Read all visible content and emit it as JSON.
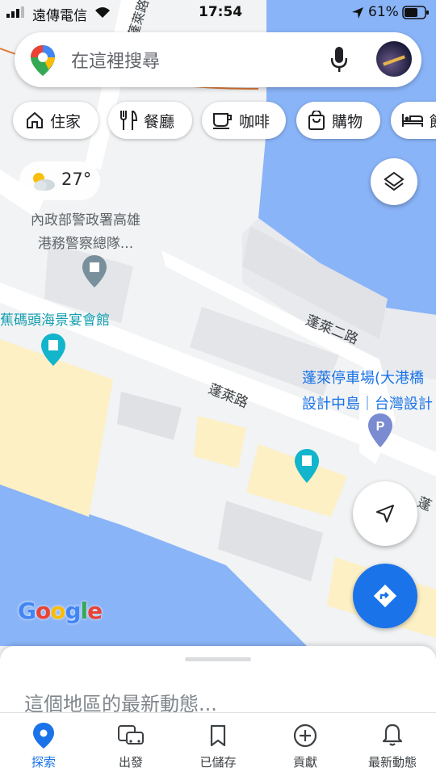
{
  "status_bar": {
    "carrier": "遠傳電信",
    "time": "17:54",
    "battery": "61%"
  },
  "search": {
    "placeholder": "在這裡搜尋"
  },
  "chips": [
    {
      "label": "住家",
      "icon": "home-icon"
    },
    {
      "label": "餐廳",
      "icon": "restaurant-icon"
    },
    {
      "label": "咖啡",
      "icon": "coffee-icon"
    },
    {
      "label": "購物",
      "icon": "shopping-bag-icon"
    },
    {
      "label": "飯",
      "icon": "hotel-icon"
    }
  ],
  "weather": {
    "temp": "27°",
    "icon": "partly-cloudy-icon"
  },
  "map": {
    "road_labels": [
      "蓬萊路",
      "蓬萊二路",
      "蓬萊路",
      "蓬"
    ],
    "places": [
      {
        "name_line1": "內政部警政署高雄",
        "name_line2": "港務警察總隊...",
        "color": "#5f6368"
      },
      {
        "name_line1": "蕉碼頭海景宴會館",
        "color": "#129eaf"
      },
      {
        "name_line1": "蓬萊停車場(大港橋",
        "name_line2": "設計中島｜台灣設計",
        "color": "#1a73e8"
      }
    ],
    "brand": "Google",
    "colors": {
      "water": "#8ab4f8",
      "land": "#f1f3f4",
      "block": "#fdf0c4",
      "building": "#e3e5e8"
    }
  },
  "sheet": {
    "title": "這個地區的最新動態..."
  },
  "bottom_nav": [
    {
      "label": "探索",
      "icon": "explore-pin-icon",
      "active": true
    },
    {
      "label": "出發",
      "icon": "commute-icon"
    },
    {
      "label": "已儲存",
      "icon": "bookmark-icon"
    },
    {
      "label": "貢獻",
      "icon": "add-circle-icon"
    },
    {
      "label": "最新動態",
      "icon": "bell-icon"
    }
  ],
  "accent": "#1a73e8"
}
